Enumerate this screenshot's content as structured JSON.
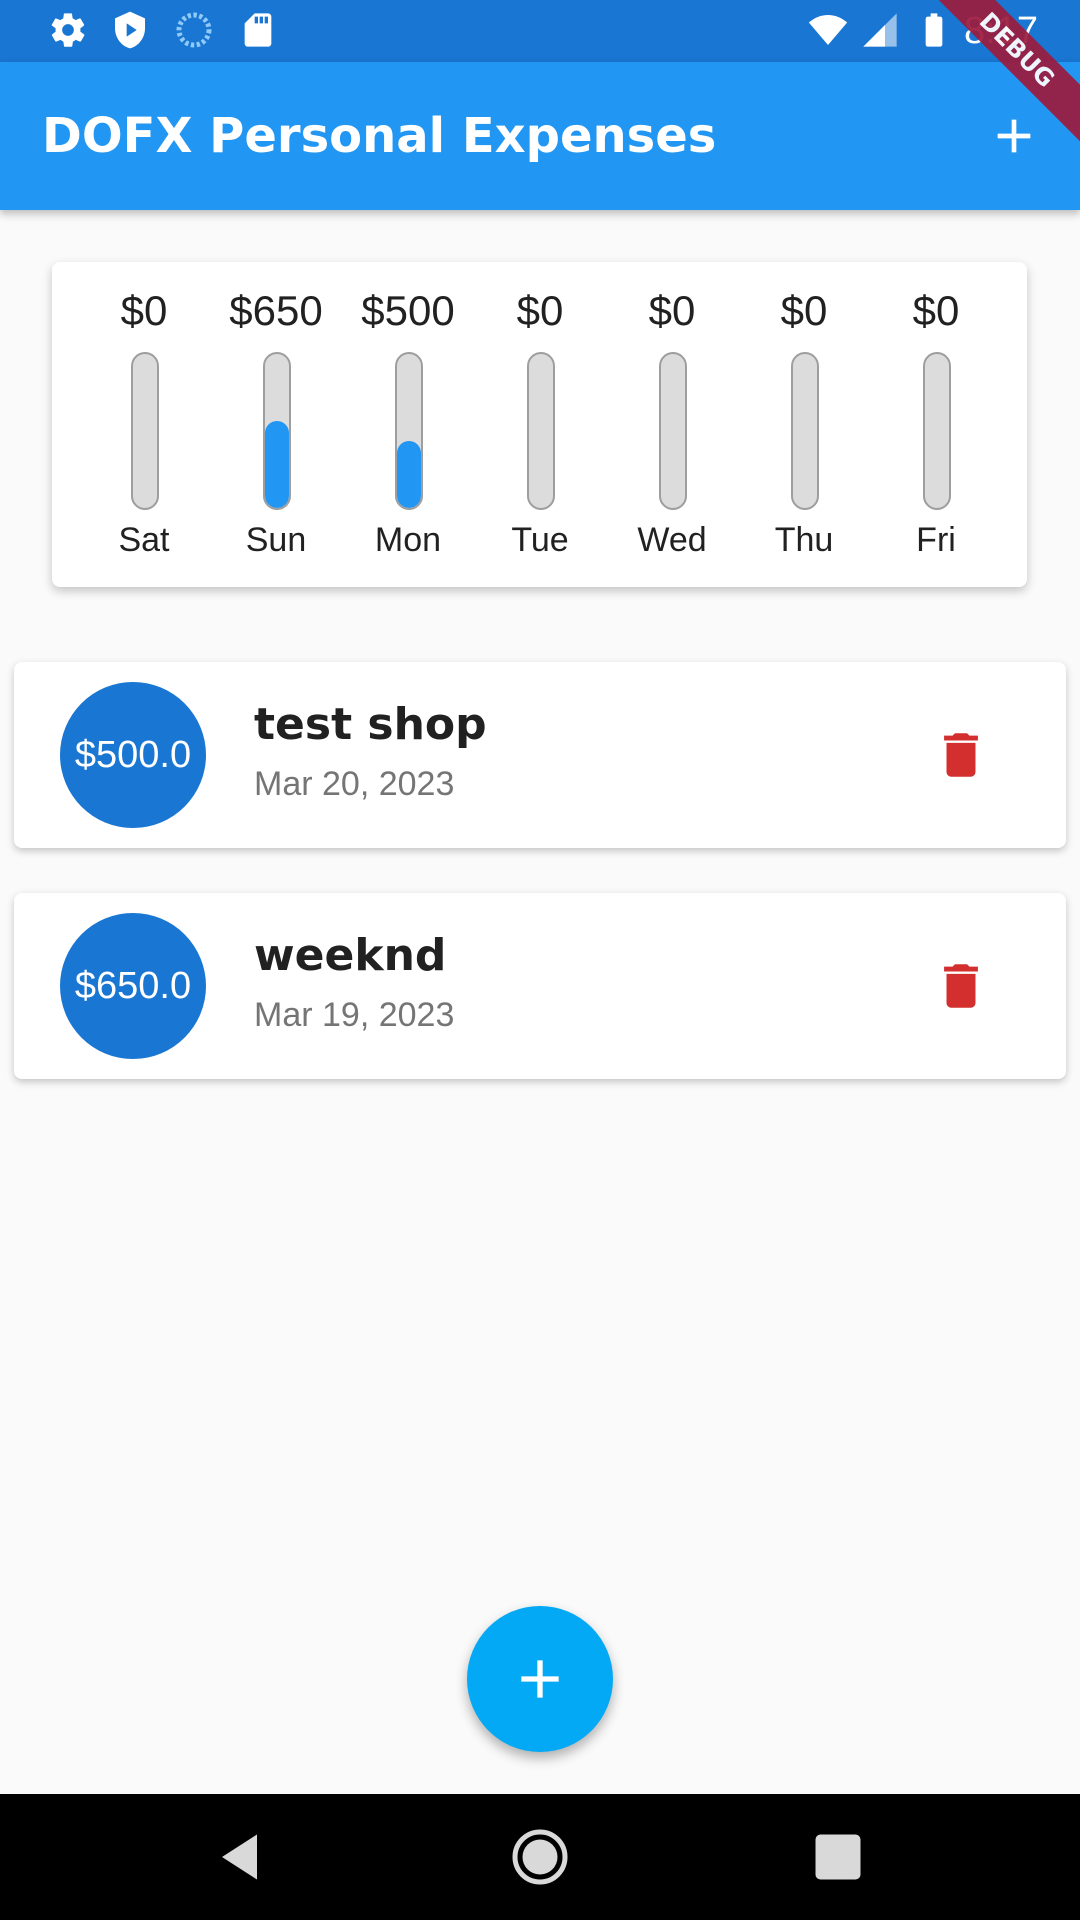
{
  "status_bar": {
    "time": "8:17",
    "icons": [
      "settings-icon",
      "shield-play-icon",
      "sync-icon",
      "sd-card-icon",
      "wifi-icon",
      "signal-icon",
      "battery-icon"
    ]
  },
  "app_bar": {
    "title": "DOFX Personal Expenses",
    "add_icon": "add-icon",
    "debug_banner": "DEBUG"
  },
  "chart_data": {
    "type": "bar",
    "categories": [
      "Sat",
      "Sun",
      "Mon",
      "Tue",
      "Wed",
      "Thu",
      "Fri"
    ],
    "values": [
      0,
      650,
      500,
      0,
      0,
      0,
      0
    ],
    "total": 1150,
    "amount_labels": [
      "$0",
      "$650",
      "$500",
      "$0",
      "$0",
      "$0",
      "$0"
    ],
    "bar_color": "#2196f3",
    "track_color": "#dcdcdc"
  },
  "transactions": [
    {
      "amount": "$500.0",
      "title": "test shop",
      "date": "Mar 20, 2023",
      "delete_icon": "trash-icon"
    },
    {
      "amount": "$650.0",
      "title": "weeknd",
      "date": "Mar 19, 2023",
      "delete_icon": "trash-icon"
    }
  ],
  "fab": {
    "icon": "add-icon",
    "color": "#03a9f4"
  },
  "nav_bar": {
    "icons": [
      "back-icon",
      "home-icon",
      "recents-icon"
    ]
  },
  "colors": {
    "primary": "#2196f3",
    "status_bar": "#1976d2",
    "avatar": "#1976d2",
    "delete": "#d32f2f"
  }
}
